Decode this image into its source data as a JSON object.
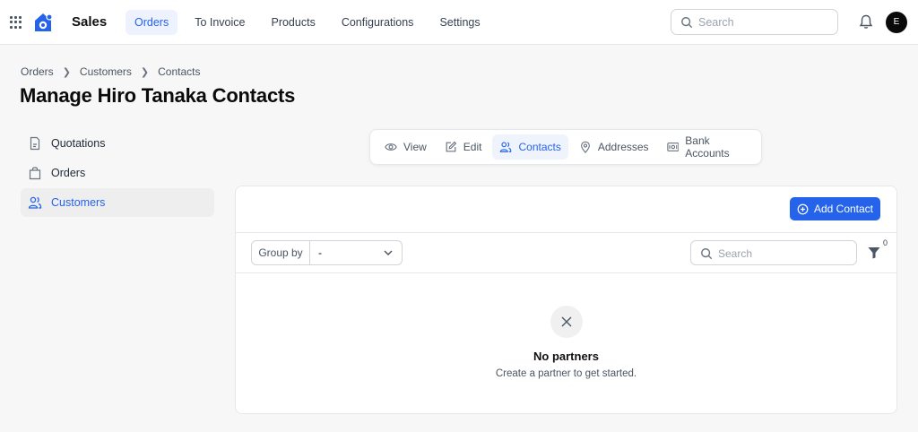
{
  "app": {
    "name": "Sales",
    "avatar_initial": "E"
  },
  "nav": {
    "items": [
      {
        "label": "Orders",
        "active": true
      },
      {
        "label": "To Invoice",
        "active": false
      },
      {
        "label": "Products",
        "active": false
      },
      {
        "label": "Configurations",
        "active": false
      },
      {
        "label": "Settings",
        "active": false
      }
    ]
  },
  "search": {
    "placeholder": "Search",
    "value": ""
  },
  "breadcrumb": [
    "Orders",
    "Customers",
    "Contacts"
  ],
  "page": {
    "title": "Manage Hiro Tanaka Contacts"
  },
  "sidebar": {
    "items": [
      {
        "label": "Quotations",
        "icon": "document-icon",
        "active": false
      },
      {
        "label": "Orders",
        "icon": "shopping-bag-icon",
        "active": false
      },
      {
        "label": "Customers",
        "icon": "users-icon",
        "active": true
      }
    ]
  },
  "tabs": [
    {
      "label": "View",
      "icon": "eye-icon",
      "active": false
    },
    {
      "label": "Edit",
      "icon": "edit-icon",
      "active": false
    },
    {
      "label": "Contacts",
      "icon": "users-icon",
      "active": true
    },
    {
      "label": "Addresses",
      "icon": "map-pin-icon",
      "active": false
    },
    {
      "label": "Bank Accounts",
      "icon": "bank-card-icon",
      "active": false
    }
  ],
  "contacts": {
    "add_button": "Add Contact",
    "group_by_label": "Group by",
    "group_by_value": "-",
    "search_placeholder": "Search",
    "filter_count": "0",
    "empty_title": "No partners",
    "empty_subtitle": "Create a partner to get started."
  },
  "colors": {
    "accent": "#2563eb",
    "accent_bg": "#eff3fb",
    "text": "#111827"
  }
}
